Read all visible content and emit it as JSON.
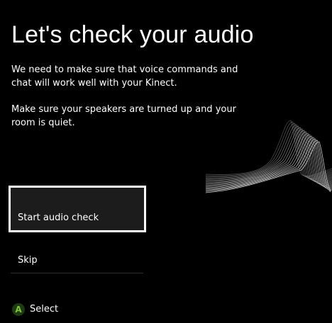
{
  "page": {
    "title": "Let's check your audio",
    "paragraphs": [
      "We need to make sure that voice commands and chat will work well with your Kinect.",
      "Make sure your speakers are turned up and your room is quiet."
    ]
  },
  "actions": {
    "primary_label": "Start audio check",
    "skip_label": "Skip"
  },
  "hint": {
    "button": "A",
    "label": "Select",
    "button_color": "#7ec241"
  },
  "decoration": {
    "icon": "sound-wave-graphic"
  }
}
